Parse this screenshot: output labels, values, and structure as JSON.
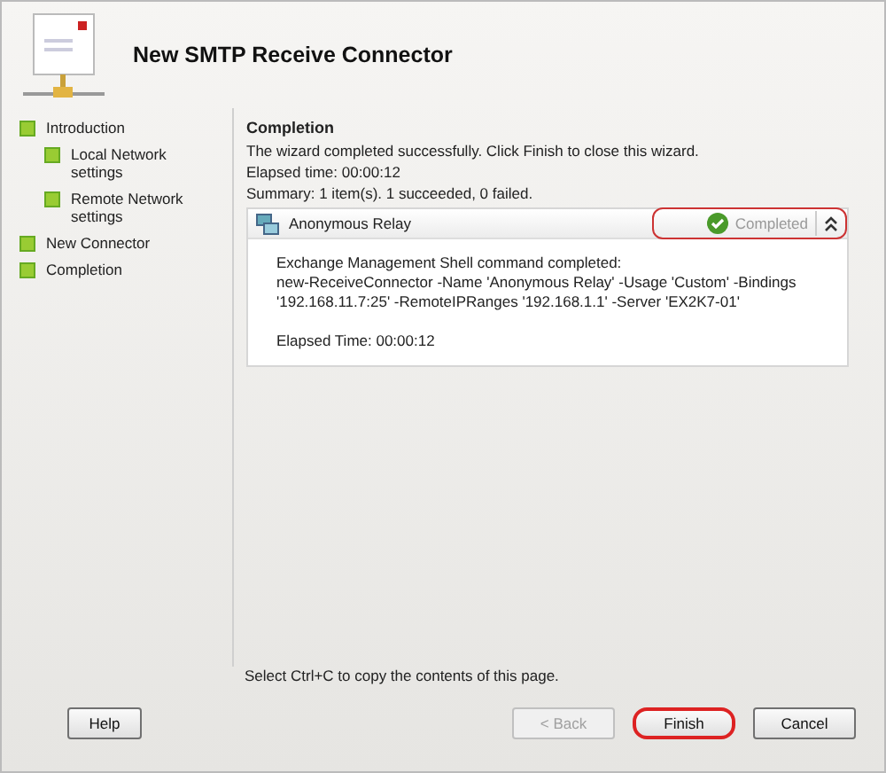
{
  "window": {
    "title": "New SMTP Receive Connector"
  },
  "steps": [
    {
      "label": "Introduction",
      "children": [
        {
          "label": "Local Network settings"
        },
        {
          "label": "Remote Network settings"
        }
      ]
    },
    {
      "label": "New Connector"
    },
    {
      "label": "Completion"
    }
  ],
  "page": {
    "heading": "Completion",
    "lines": [
      "The wizard completed successfully. Click Finish to close this wizard.",
      "Elapsed time: 00:00:12",
      "Summary: 1 item(s). 1 succeeded, 0 failed."
    ]
  },
  "task": {
    "name": "Anonymous Relay",
    "status": "Completed",
    "status_highlighted": true,
    "expanded": true,
    "details": [
      "Exchange Management Shell command completed:",
      "new-ReceiveConnector -Name 'Anonymous Relay' -Usage 'Custom' -Bindings '192.168.11.7:25' -RemoteIPRanges '192.168.1.1' -Server 'EX2K7-01'"
    ],
    "elapsed": "Elapsed Time: 00:00:12"
  },
  "hint": "Select Ctrl+C to copy the contents of this page.",
  "buttons": [
    {
      "label": "Help",
      "disabled": false,
      "highlighted": false,
      "kind": "help"
    },
    {
      "label": "< Back",
      "disabled": true,
      "highlighted": false,
      "kind": "nav"
    },
    {
      "label": "Finish",
      "disabled": false,
      "highlighted": true,
      "kind": "nav"
    },
    {
      "label": "Cancel",
      "disabled": false,
      "highlighted": false,
      "kind": "nav"
    }
  ]
}
